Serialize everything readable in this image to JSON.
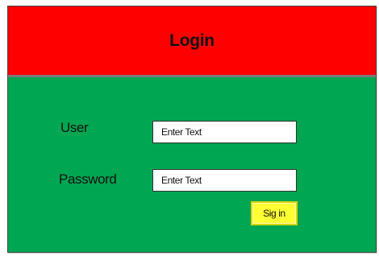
{
  "header": {
    "title": "Login"
  },
  "form": {
    "user_label": "User",
    "user_field_value": "Enter Text",
    "password_label": "Password",
    "password_field_value": "Enter Text",
    "signin_label": "Sig in"
  },
  "colors": {
    "header_background": "#ff0000",
    "body_background": "#00a651",
    "button_background": "#ffff33"
  }
}
